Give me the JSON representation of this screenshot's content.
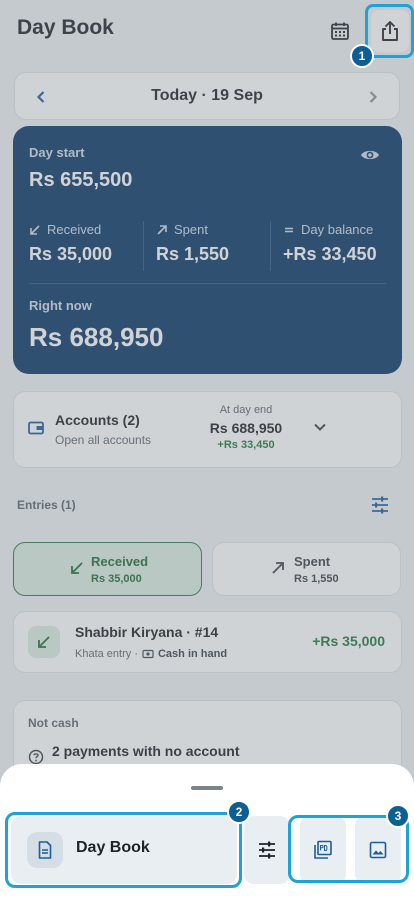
{
  "header": {
    "title": "Day Book",
    "calendar_icon": "calendar-icon",
    "share_icon": "share-icon"
  },
  "date_nav": {
    "label": "Today · 19 Sep"
  },
  "summary": {
    "day_start_label": "Day start",
    "day_start_value": "Rs 655,500",
    "received_label": "Received",
    "received_value": "Rs 35,000",
    "spent_label": "Spent",
    "spent_value": "Rs 1,550",
    "balance_label": "Day balance",
    "balance_value": "+Rs 33,450",
    "right_now_label": "Right now",
    "right_now_value": "Rs 688,950"
  },
  "accounts": {
    "title": "Accounts (2)",
    "subtitle": "Open all accounts",
    "end_label": "At day end",
    "end_value": "Rs 688,950",
    "end_delta": "+Rs 33,450"
  },
  "entries": {
    "label": "Entries (1)",
    "tabs": [
      {
        "label": "Received",
        "amount": "Rs 35,000"
      },
      {
        "label": "Spent",
        "amount": "Rs 1,550"
      }
    ],
    "items": [
      {
        "name": "Shabbir Kiryana · #14",
        "type": "Khata entry ·",
        "method": "Cash in hand",
        "amount": "+Rs 35,000"
      }
    ]
  },
  "not_cash": {
    "label": "Not cash",
    "text": "2 payments with no account"
  },
  "sheet": {
    "primary_label": "Day Book",
    "pdf_icon": "pdf-icon",
    "image_icon": "image-icon"
  },
  "annotations": [
    "1",
    "2",
    "3"
  ],
  "colors": {
    "card": "#0a3766",
    "accent": "#1da3d6",
    "positive": "#1e7a3a"
  }
}
